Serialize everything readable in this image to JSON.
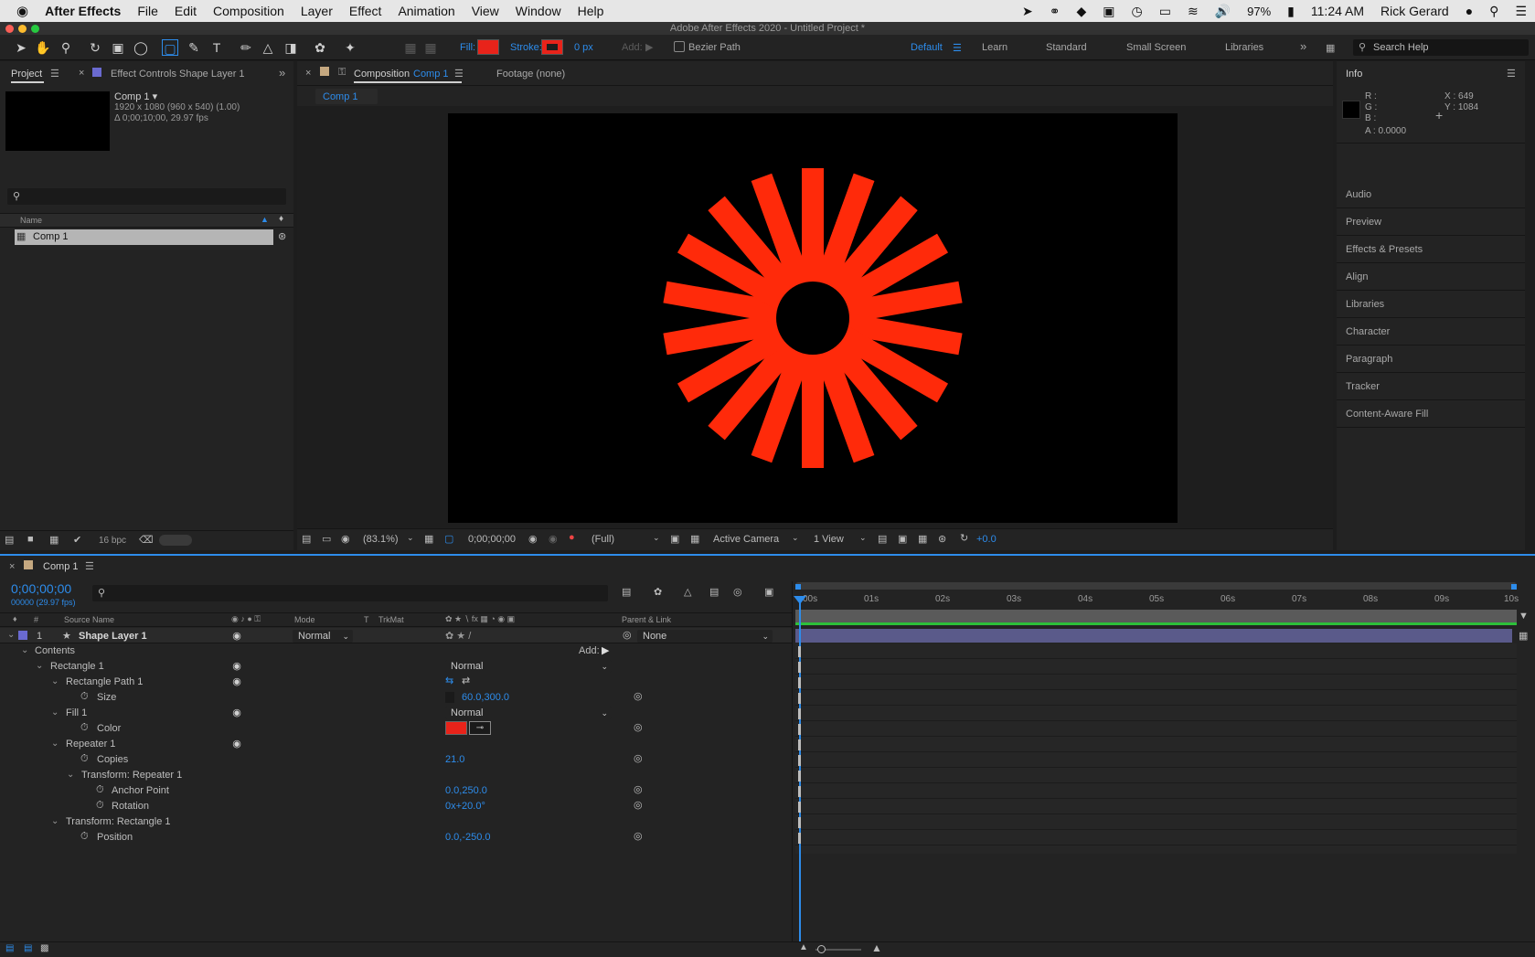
{
  "menubar": {
    "apple": "",
    "app": "After Effects",
    "items": [
      "File",
      "Edit",
      "Composition",
      "Layer",
      "Effect",
      "Animation",
      "View",
      "Window",
      "Help"
    ],
    "battery": "97%",
    "time": "11:24 AM",
    "user": "Rick Gerard"
  },
  "window_title": "Adobe After Effects 2020 - Untitled Project *",
  "toolbar": {
    "fill_label": "Fill:",
    "stroke_label": "Stroke:",
    "stroke_width": "0 px",
    "add_label": "Add:",
    "bezier_label": "Bezier Path",
    "fill_color": "#e8231a",
    "stroke_color": "#e8231a"
  },
  "workspaces": {
    "items": [
      "Default",
      "Learn",
      "Standard",
      "Small Screen",
      "Libraries"
    ],
    "active": "Default",
    "search_placeholder": "Search Help"
  },
  "project": {
    "tab": "Project",
    "effect_tab": "Effect Controls Shape Layer 1",
    "comp_name": "Comp 1 ▾",
    "comp_size": "1920 x 1080  (960 x 540) (1.00)",
    "comp_duration": "Δ 0;00;10;00, 29.97 fps",
    "search_placeholder": "",
    "col_name": "Name",
    "item": "Comp 1",
    "bpc": "16 bpc"
  },
  "composition": {
    "tab_prefix": "Composition",
    "tab_name": "Comp 1",
    "footage": "Footage (none)",
    "breadcrumb": "Comp 1",
    "zoom": "(83.1%)",
    "timecode": "0;00;00;00",
    "resolution": "(Full)",
    "camera": "Active Camera",
    "views": "1 View",
    "exposure": "+0.0"
  },
  "starburst": {
    "copies": 21,
    "rotation_step": 20,
    "color": "#ff2a0a",
    "bg": "#000000"
  },
  "info": {
    "tab": "Info",
    "r": "R :",
    "g": "G :",
    "b": "B :",
    "a": "A :  0.0000",
    "x": "X : 649",
    "y": "Y : 1084",
    "panels": [
      "Audio",
      "Preview",
      "Effects & Presets",
      "Align",
      "Libraries",
      "Character",
      "Paragraph",
      "Tracker",
      "Content-Aware Fill"
    ]
  },
  "timeline": {
    "tab": "Comp 1",
    "timecode": "0;00;00;00",
    "frame_info": "00000 (29.97 fps)",
    "cols": {
      "num": "#",
      "source": "Source Name",
      "mode": "Mode",
      "t": "T",
      "trkmat": "TrkMat",
      "parent": "Parent & Link"
    },
    "layer": {
      "num": "1",
      "name": "Shape Layer 1",
      "mode": "Normal",
      "parent": "None"
    },
    "ticks": [
      "00s",
      "01s",
      "02s",
      "03s",
      "04s",
      "05s",
      "06s",
      "07s",
      "08s",
      "09s",
      "10s"
    ],
    "props": [
      {
        "label": "Contents",
        "value": "Add:"
      },
      {
        "label": "Rectangle 1",
        "value": "Normal"
      },
      {
        "label": "Rectangle Path 1",
        "value": ""
      },
      {
        "label": "Size",
        "value": "60.0,300.0"
      },
      {
        "label": "Fill 1",
        "value": "Normal"
      },
      {
        "label": "Color",
        "value": ""
      },
      {
        "label": "Repeater 1",
        "value": ""
      },
      {
        "label": "Copies",
        "value": "21.0"
      },
      {
        "label": "Transform: Repeater 1",
        "value": ""
      },
      {
        "label": "Anchor Point",
        "value": "0.0,250.0"
      },
      {
        "label": "Rotation",
        "value": "0x+20.0°"
      },
      {
        "label": "Transform: Rectangle 1",
        "value": ""
      },
      {
        "label": "Position",
        "value": "0.0,-250.0"
      }
    ]
  }
}
